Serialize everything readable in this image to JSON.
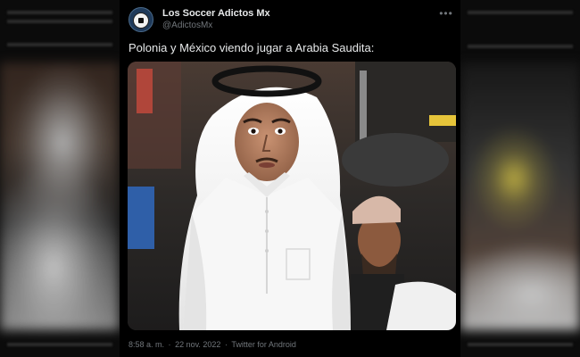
{
  "tweet": {
    "display_name": "Los Soccer Adictos Mx",
    "handle": "@AdictosMx",
    "text": "Polonia y México viendo jugar a Arabia Saudita:",
    "time": "8:58 a. m.",
    "date": "22 nov. 2022",
    "source": "Twitter for Android",
    "separator": "·"
  },
  "icons": {
    "avatar": "soccer-ball-logo",
    "more": "more-horizontal-icon"
  }
}
